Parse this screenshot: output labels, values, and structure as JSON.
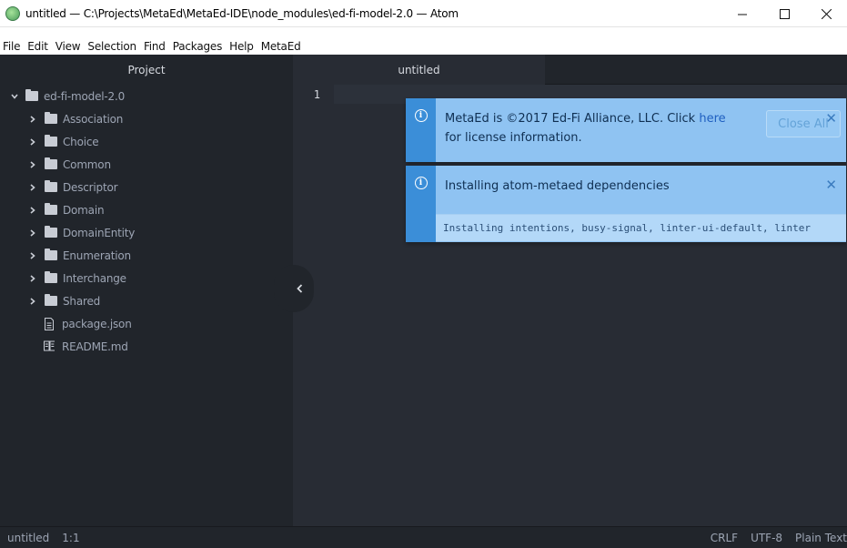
{
  "window": {
    "title": "untitled — C:\\Projects\\MetaEd\\MetaEd-IDE\\node_modules\\ed-fi-model-2.0 — Atom",
    "minimize_glyph": "—",
    "maximize_glyph": "☐",
    "close_glyph": "✕"
  },
  "menu": [
    "File",
    "Edit",
    "View",
    "Selection",
    "Find",
    "Packages",
    "Help",
    "MetaEd"
  ],
  "panels": {
    "project_header": "Project",
    "active_tab": "untitled"
  },
  "tree": {
    "root": "ed-fi-model-2.0",
    "folders": [
      "Association",
      "Choice",
      "Common",
      "Descriptor",
      "Domain",
      "DomainEntity",
      "Enumeration",
      "Interchange",
      "Shared"
    ],
    "files": [
      {
        "name": "package.json",
        "icon": "file-text-icon"
      },
      {
        "name": "README.md",
        "icon": "book-icon"
      }
    ]
  },
  "editor": {
    "line_number": "1"
  },
  "notifications": [
    {
      "message_prefix": "MetaEd is ©2017 Ed-Fi Alliance, LLC. Click",
      "message_link": "here",
      "message_suffix": " for license information.",
      "close_all_label": "Close All",
      "close_glyph": "✕"
    },
    {
      "message": "Installing atom-metaed dependencies",
      "detail": "Installing intentions, busy-signal, linter-ui-default, linter",
      "close_glyph": "✕"
    }
  ],
  "status": {
    "file": "untitled",
    "position": "1:1",
    "line_ending": "CRLF",
    "encoding": "UTF-8",
    "grammar": "Plain Text"
  },
  "colors": {
    "accent": "#3b8ed8",
    "notification_bg": "#8fc3f2",
    "background": "#21252b",
    "editor_bg": "#282c34"
  }
}
